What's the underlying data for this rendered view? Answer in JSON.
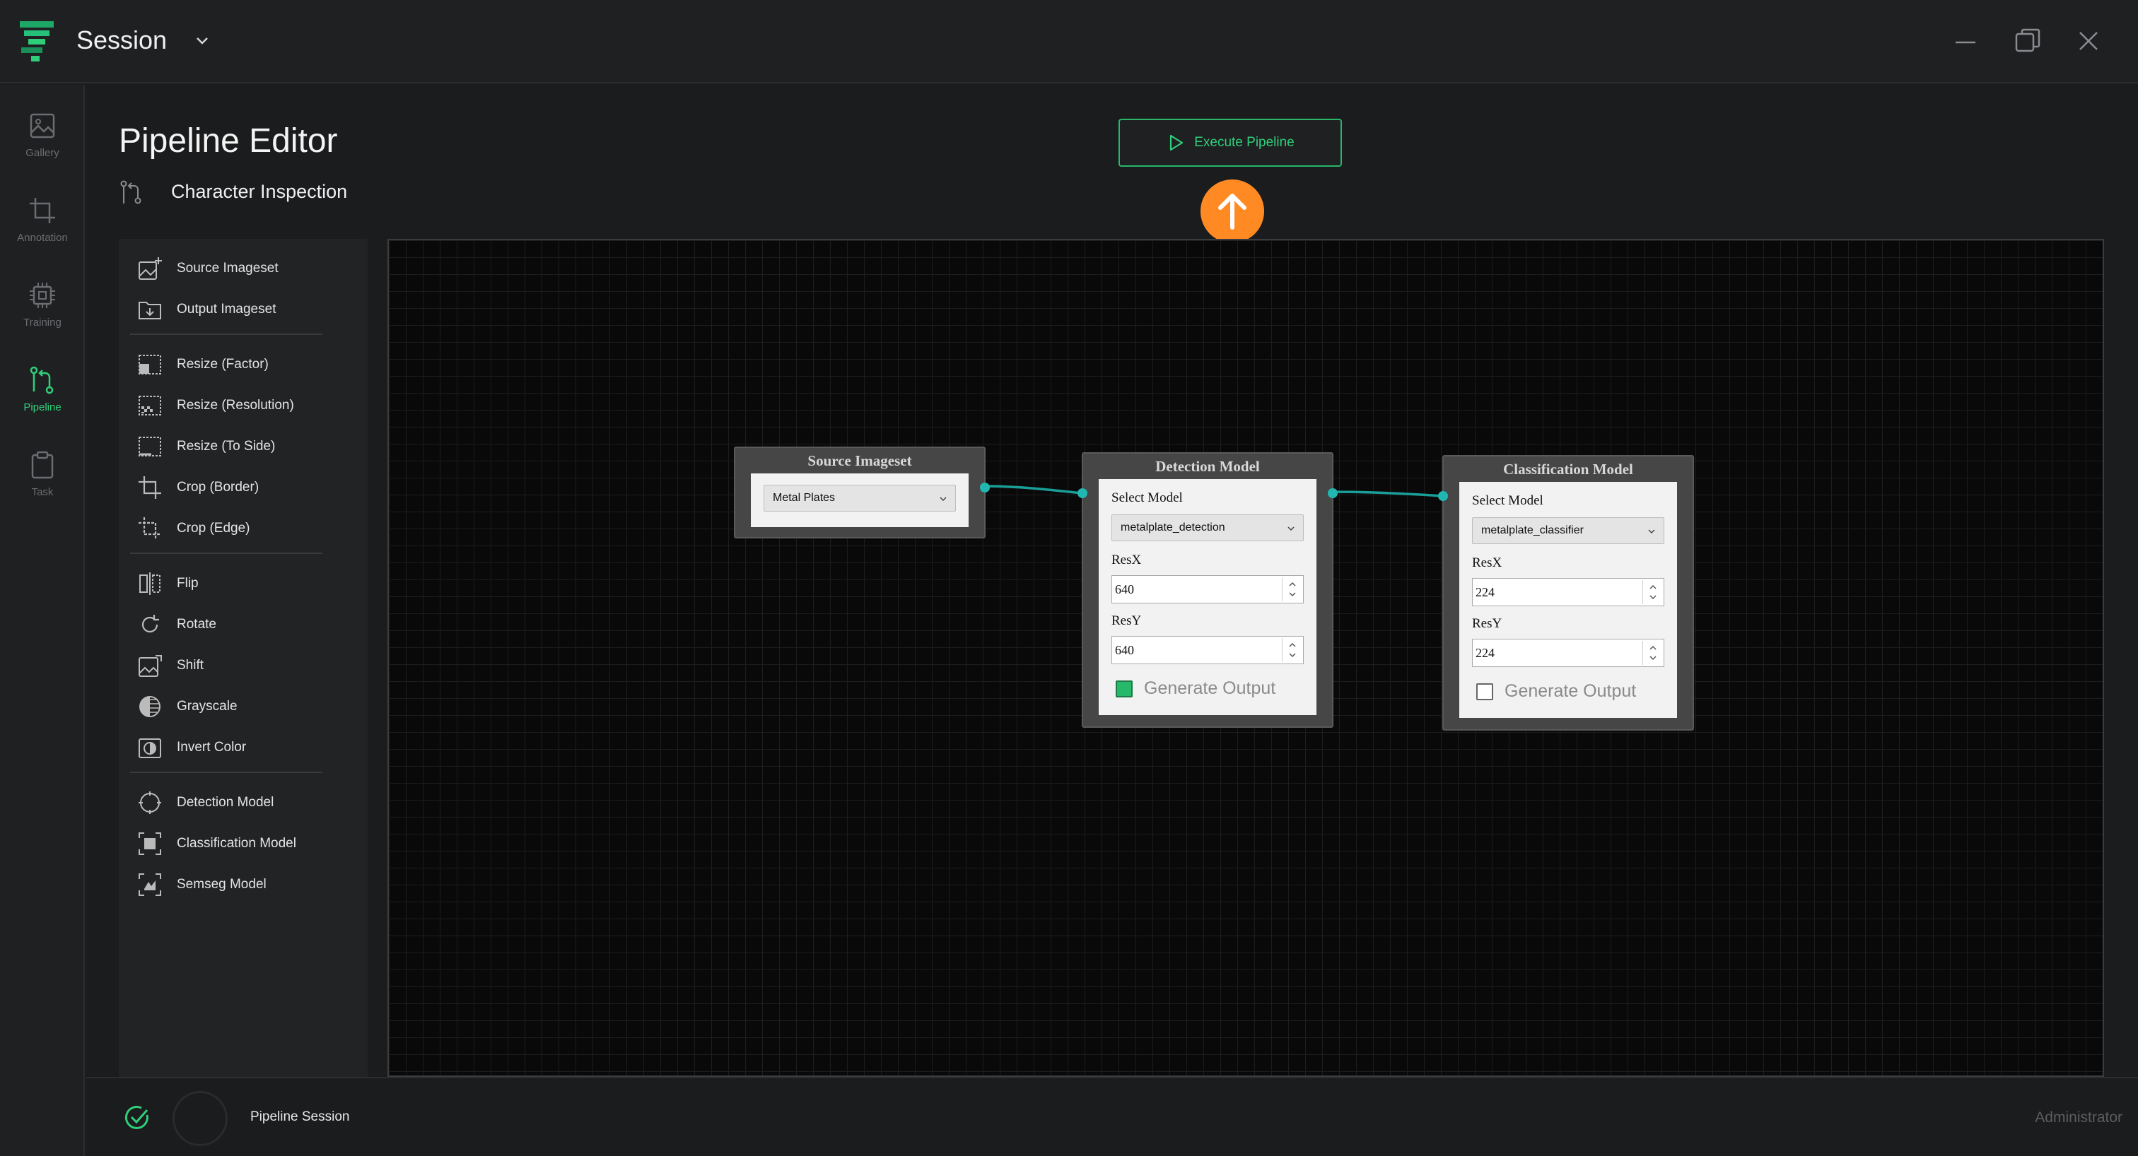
{
  "app": {
    "title": "Session"
  },
  "rail": {
    "items": [
      {
        "label": "Gallery",
        "icon": "image-icon",
        "active": false
      },
      {
        "label": "Annotation",
        "icon": "crop-icon",
        "active": false
      },
      {
        "label": "Training",
        "icon": "chip-icon",
        "active": false
      },
      {
        "label": "Pipeline",
        "icon": "pipeline-icon",
        "active": true
      },
      {
        "label": "Task",
        "icon": "clipboard-icon",
        "active": false
      }
    ]
  },
  "header": {
    "title": "Pipeline Editor",
    "pipeline_name": "Character Inspection",
    "execute_label": "Execute Pipeline"
  },
  "palette": {
    "items": [
      {
        "label": "Source Imageset",
        "icon": "image-add-icon"
      },
      {
        "label": "Output Imageset",
        "icon": "folder-out-icon"
      },
      {
        "label": "Resize (Factor)",
        "icon": "resize-factor-icon"
      },
      {
        "label": "Resize (Resolution)",
        "icon": "resize-resolution-icon"
      },
      {
        "label": "Resize (To Side)",
        "icon": "resize-side-icon"
      },
      {
        "label": "Crop (Border)",
        "icon": "crop-border-icon"
      },
      {
        "label": "Crop (Edge)",
        "icon": "crop-edge-icon"
      },
      {
        "label": "Flip",
        "icon": "flip-icon"
      },
      {
        "label": "Rotate",
        "icon": "rotate-icon"
      },
      {
        "label": "Shift",
        "icon": "shift-icon"
      },
      {
        "label": "Grayscale",
        "icon": "grayscale-icon"
      },
      {
        "label": "Invert Color",
        "icon": "invert-color-icon"
      },
      {
        "label": "Detection Model",
        "icon": "detection-icon"
      },
      {
        "label": "Classification Model",
        "icon": "classification-icon"
      },
      {
        "label": "Semseg Model",
        "icon": "semseg-icon"
      }
    ]
  },
  "nodes": {
    "source": {
      "title": "Source Imageset",
      "selected": "Metal Plates"
    },
    "detection": {
      "title": "Detection Model",
      "select_label": "Select Model",
      "model": "metalplate_detection",
      "resx_label": "ResX",
      "resx": "640",
      "resy_label": "ResY",
      "resy": "640",
      "output_label": "Generate Output",
      "generate_output": true
    },
    "classification": {
      "title": "Classification Model",
      "select_label": "Select Model",
      "model": "metalplate_classifier",
      "resx_label": "ResX",
      "resx": "224",
      "resy_label": "ResY",
      "resy": "224",
      "output_label": "Generate Output",
      "generate_output": false
    }
  },
  "status": {
    "session": "Pipeline Session",
    "user": "Administrator"
  },
  "colors": {
    "accent": "#2fcf7a",
    "link": "#22b6b0",
    "hint": "#ff8a24",
    "canvas": "#090909"
  }
}
